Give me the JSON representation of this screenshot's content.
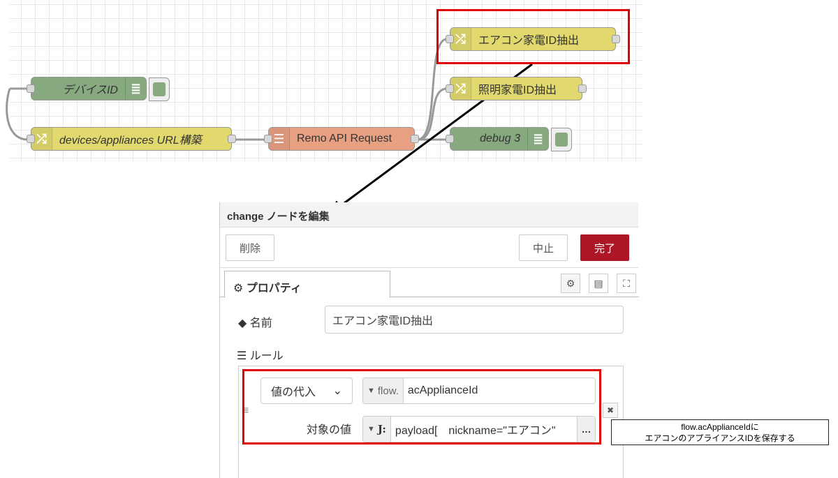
{
  "flow": {
    "nodes": {
      "ac_extract": "エアコン家電ID抽出",
      "light_extract": "照明家電ID抽出",
      "device_id": "デバイスID",
      "url_build": "devices/appliances URL構築",
      "api_request": "Remo API Request",
      "debug3": "debug 3"
    }
  },
  "dialog": {
    "title": "change ノードを編集",
    "delete_label": "削除",
    "cancel_label": "中止",
    "done_label": "完了",
    "tab_properties": "プロパティ",
    "name_label": "名前",
    "name_value": "エアコン家電ID抽出",
    "rules_label": "ルール",
    "rule": {
      "action": "値の代入",
      "target_type": "flow.",
      "target_value": "acApplianceId",
      "value_label": "対象の値",
      "value_type": "J:",
      "value_expr": "payload[　nickname=\"エアコン\"",
      "expand": "…"
    }
  },
  "callout": {
    "line1": "flow.acApplianceIdに",
    "line2": "エアコンのアプライアンスIDを保存する"
  },
  "colors": {
    "change_node": "#e2d96e",
    "debug_node": "#87a980",
    "function_node": "#e8a083",
    "highlight": "#e00000",
    "done_button": "#ad1625"
  }
}
